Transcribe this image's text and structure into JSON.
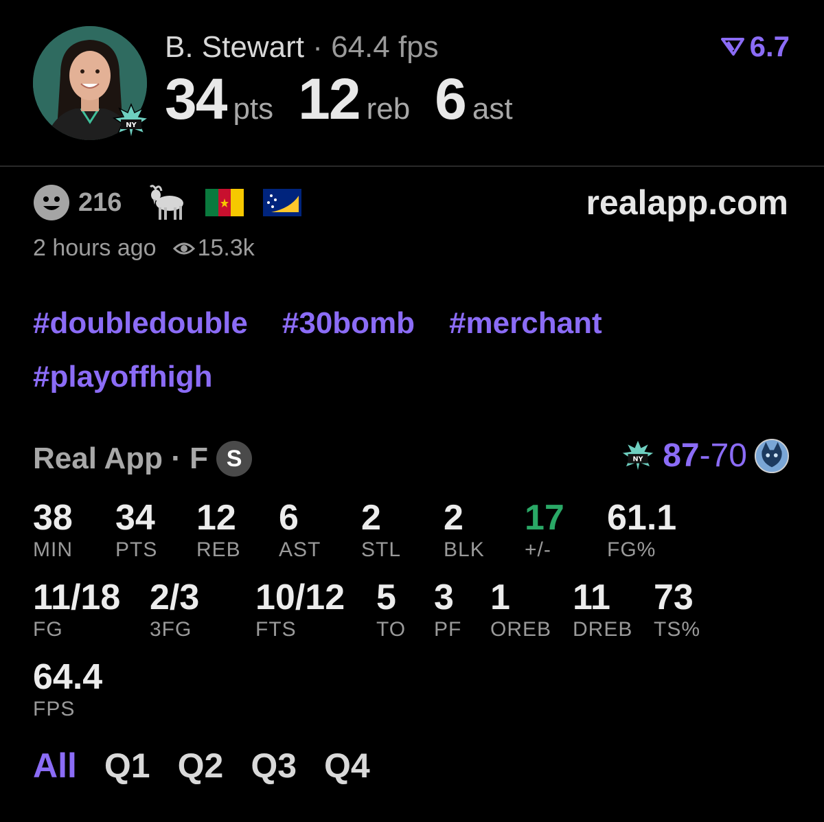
{
  "player": {
    "name": "B. Stewart",
    "separator": "·",
    "fps_label": "64.4 fps",
    "rating": "6.7",
    "stats": [
      {
        "value": "34",
        "unit": "pts"
      },
      {
        "value": "12",
        "unit": "reb"
      },
      {
        "value": "6",
        "unit": "ast"
      }
    ]
  },
  "meta": {
    "likes": "216",
    "site": "realapp.com",
    "time_ago": "2 hours ago",
    "views": "15.3k"
  },
  "hashtags": [
    "#doubledouble",
    "#30bomb",
    "#merchant",
    "#playoffhigh"
  ],
  "game": {
    "label": "Real App · F",
    "badge": "S",
    "home_score": "87",
    "dash": "-",
    "away_score": "70"
  },
  "stats": {
    "row1": [
      {
        "value": "38",
        "label": "MIN"
      },
      {
        "value": "34",
        "label": "PTS"
      },
      {
        "value": "12",
        "label": "REB"
      },
      {
        "value": "6",
        "label": "AST"
      },
      {
        "value": "2",
        "label": "STL"
      },
      {
        "value": "2",
        "label": "BLK"
      },
      {
        "value": "17",
        "label": "+/-"
      },
      {
        "value": "61.1",
        "label": "FG%"
      }
    ],
    "row2": [
      {
        "value": "11/18",
        "label": "FG"
      },
      {
        "value": "2/3",
        "label": "3FG"
      },
      {
        "value": "10/12",
        "label": "FTS"
      },
      {
        "value": "5",
        "label": "TO"
      },
      {
        "value": "3",
        "label": "PF"
      },
      {
        "value": "1",
        "label": "OREB"
      },
      {
        "value": "11",
        "label": "DREB"
      },
      {
        "value": "73",
        "label": "TS%"
      }
    ],
    "row3": [
      {
        "value": "64.4",
        "label": "FPS"
      }
    ]
  },
  "tabs": [
    "All",
    "Q1",
    "Q2",
    "Q3",
    "Q4"
  ],
  "colors": {
    "accent": "#8b6cf6",
    "positive": "#2aa866",
    "background": "#000000"
  },
  "icons": [
    "player-avatar",
    "liberty-logo-icon",
    "rating-arrow-icon",
    "smiley-icon",
    "goat-icon",
    "cameroon-flag-icon",
    "tokelau-flag-icon",
    "eye-icon",
    "lynx-logo-icon"
  ]
}
